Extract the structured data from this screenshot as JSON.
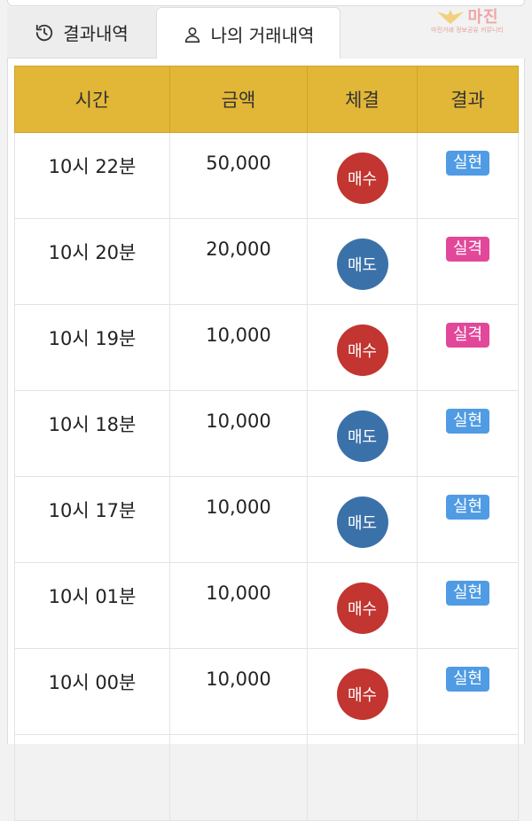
{
  "tabs": [
    {
      "label": "결과내역",
      "icon": "history-icon"
    },
    {
      "label": "나의 거래내역",
      "icon": "user-icon"
    }
  ],
  "logo": {
    "text": "마진",
    "subtext": "마진거래 정보공유 커뮤니티"
  },
  "table": {
    "headers": [
      "시간",
      "금액",
      "체결",
      "결과"
    ],
    "rows": [
      {
        "time": "10시 22분",
        "amount": "50,000",
        "execution": "매수",
        "result": "실현"
      },
      {
        "time": "10시 20분",
        "amount": "20,000",
        "execution": "매도",
        "result": "실격"
      },
      {
        "time": "10시 19분",
        "amount": "10,000",
        "execution": "매수",
        "result": "실격"
      },
      {
        "time": "10시 18분",
        "amount": "10,000",
        "execution": "매도",
        "result": "실현"
      },
      {
        "time": "10시 17분",
        "amount": "10,000",
        "execution": "매도",
        "result": "실현"
      },
      {
        "time": "10시 01분",
        "amount": "10,000",
        "execution": "매수",
        "result": "실현"
      },
      {
        "time": "10시 00분",
        "amount": "10,000",
        "execution": "매수",
        "result": "실현"
      }
    ]
  },
  "colors": {
    "header_bg": "#e2b737",
    "buy": "#c23530",
    "sell": "#3b71a9",
    "hit": "#4f9be4",
    "miss": "#e2479a"
  }
}
